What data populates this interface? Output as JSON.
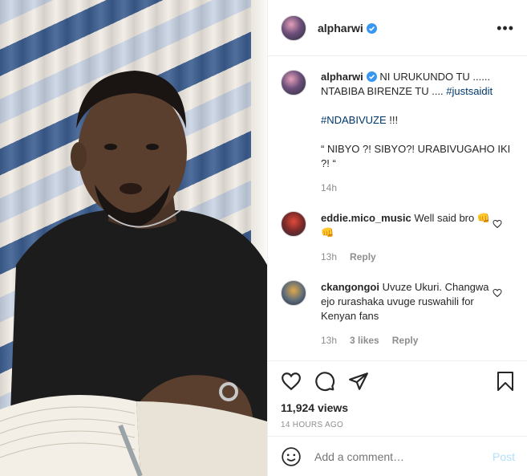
{
  "post": {
    "username": "alpharwi",
    "more_icon": "more-horizontal-icon",
    "caption": {
      "line1_prefix": "NI URUKUNDO TU ...... NTABIBA BIRENZE TU .... ",
      "line1_tag": "#justsaidit",
      "line2_tag": "#NDABIVUZE",
      "line2_suffix": " !!!",
      "line3": "“ NIBYO ?! SIBYO?! URABIVUGAHO IKI ?! “",
      "time": "14h"
    },
    "comments": [
      {
        "username": "eddie.mico_music",
        "text": "Well said bro 👊 👊",
        "time": "13h",
        "likes": "",
        "reply": "Reply"
      },
      {
        "username": "ckangongoi",
        "text": "Uvuze Ukuri. Changwa ejo rurashaka uvuge ruswahili for Kenyan fans",
        "time": "13h",
        "likes": "3 likes",
        "reply": "Reply"
      }
    ],
    "views": "11,924 views",
    "posted": "14 HOURS AGO",
    "add_comment_placeholder": "Add a comment…",
    "post_button": "Post",
    "colors": {
      "link": "#00376b",
      "muted": "#8e8e8e",
      "verified": "#3897f0",
      "post_disabled": "#b2dffc"
    }
  }
}
